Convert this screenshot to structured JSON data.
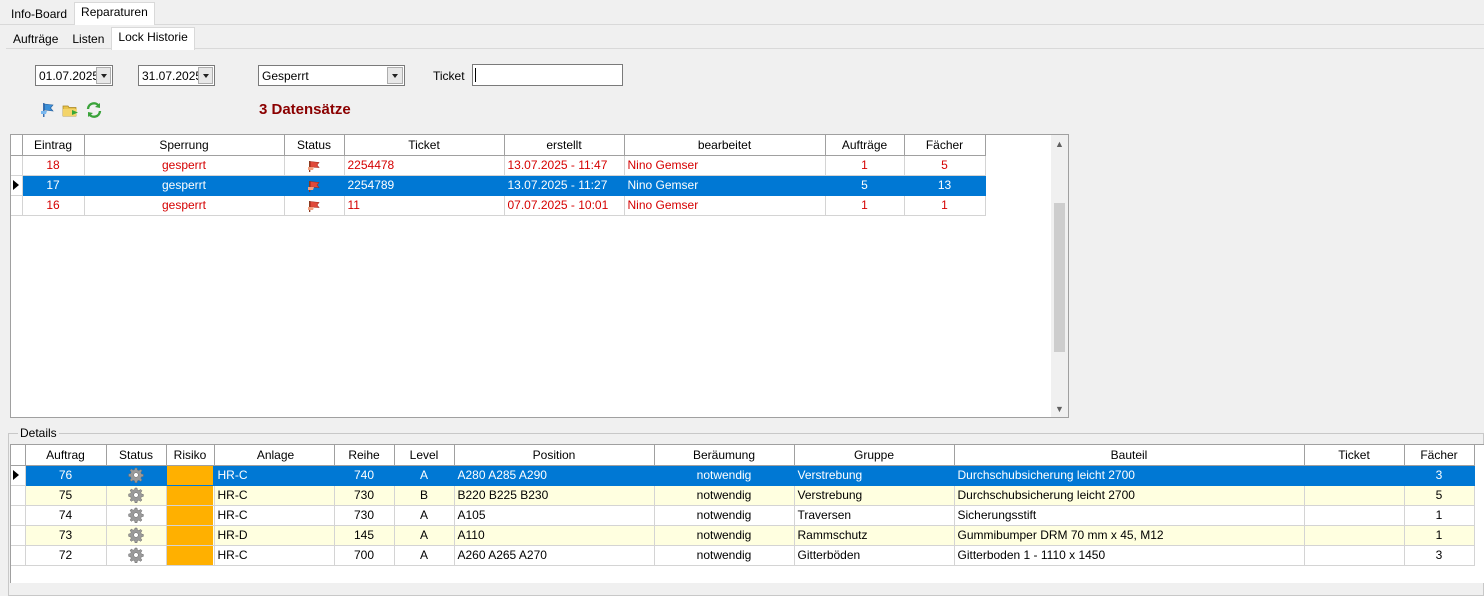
{
  "tabs_top": [
    "Info-Board",
    "Reparaturen"
  ],
  "tabs_sub": [
    "Aufträge",
    "Listen",
    "Lock Historie"
  ],
  "filters": {
    "date_from": "01.07.2025",
    "date_to": "31.07.2025",
    "status": "Gesperrt",
    "ticket_label": "Ticket",
    "ticket_value": ""
  },
  "toolbar": {
    "icons": [
      "flag-filter-icon",
      "folder-export-icon",
      "refresh-icon"
    ],
    "record_count": "3 Datensätze"
  },
  "locks_grid": {
    "columns": [
      "Eintrag",
      "Sperrung",
      "Status",
      "Ticket",
      "erstellt",
      "bearbeitet",
      "Aufträge",
      "Fächer"
    ],
    "rows": [
      {
        "eintrag": "18",
        "sperrung": "gesperrt",
        "status_icon": "red-flag-icon",
        "ticket": "2254478",
        "erstellt": "13.07.2025 - 11:47",
        "bearbeitet": "Nino Gemser",
        "auftraege": "1",
        "faecher": "5"
      },
      {
        "eintrag": "17",
        "sperrung": "gesperrt",
        "status_icon": "red-flag-icon",
        "ticket": "2254789",
        "erstellt": "13.07.2025 - 11:27",
        "bearbeitet": "Nino Gemser",
        "auftraege": "5",
        "faecher": "13"
      },
      {
        "eintrag": "16",
        "sperrung": "gesperrt",
        "status_icon": "red-flag-icon",
        "ticket": "11",
        "erstellt": "07.07.2025 - 10:01",
        "bearbeitet": "Nino Gemser",
        "auftraege": "1",
        "faecher": "1"
      }
    ],
    "selected_index": 1
  },
  "details": {
    "legend": "Details",
    "columns": [
      "Auftrag",
      "Status",
      "Risiko",
      "Anlage",
      "Reihe",
      "Level",
      "Position",
      "Beräumung",
      "Gruppe",
      "Bauteil",
      "Ticket",
      "Fächer"
    ],
    "rows": [
      {
        "auftrag": "76",
        "status_icon": "gear-icon",
        "risiko_color": "#ffb000",
        "anlage": "HR-C",
        "reihe": "740",
        "level": "A",
        "position": "A280 A285 A290",
        "beraeumung": "notwendig",
        "gruppe": "Verstrebung",
        "bauteil": "Durchschubsicherung leicht 2700",
        "ticket": "",
        "faecher": "3"
      },
      {
        "auftrag": "75",
        "status_icon": "gear-icon",
        "risiko_color": "#ffb000",
        "anlage": "HR-C",
        "reihe": "730",
        "level": "B",
        "position": "B220 B225 B230",
        "beraeumung": "notwendig",
        "gruppe": "Verstrebung",
        "bauteil": "Durchschubsicherung leicht 2700",
        "ticket": "",
        "faecher": "5"
      },
      {
        "auftrag": "74",
        "status_icon": "gear-icon",
        "risiko_color": "#ffb000",
        "anlage": "HR-C",
        "reihe": "730",
        "level": "A",
        "position": "A105",
        "beraeumung": "notwendig",
        "gruppe": "Traversen",
        "bauteil": "Sicherungsstift",
        "ticket": "",
        "faecher": "1"
      },
      {
        "auftrag": "73",
        "status_icon": "gear-icon",
        "risiko_color": "#ffb000",
        "anlage": "HR-D",
        "reihe": "145",
        "level": "A",
        "position": "A110",
        "beraeumung": "notwendig",
        "gruppe": "Rammschutz",
        "bauteil": "Gummibumper DRM 70 mm x 45, M12",
        "ticket": "",
        "faecher": "1"
      },
      {
        "auftrag": "72",
        "status_icon": "gear-icon",
        "risiko_color": "#ffb000",
        "anlage": "HR-C",
        "reihe": "700",
        "level": "A",
        "position": "A260 A265 A270",
        "beraeumung": "notwendig",
        "gruppe": "Gitterböden",
        "bauteil": "Gitterboden 1 - 1110 x 1450",
        "ticket": "",
        "faecher": "3"
      }
    ],
    "selected_index": 0,
    "yellow_rows": [
      1,
      3
    ]
  },
  "colors": {
    "selection": "#0078d4",
    "locked_text": "#d40000",
    "record_count": "#8b0000",
    "risk": "#ffb000",
    "alt_row": "#ffffe0"
  }
}
